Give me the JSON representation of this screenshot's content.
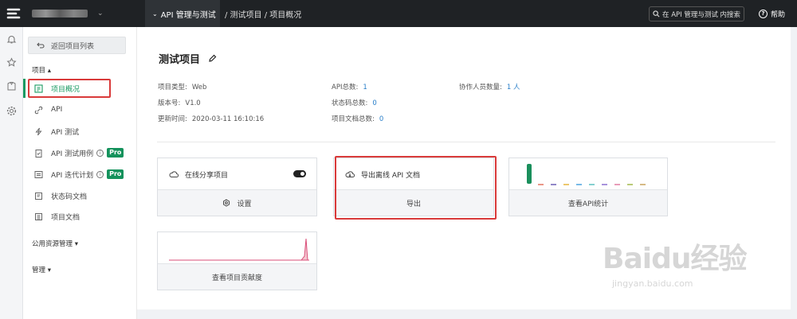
{
  "topbar": {
    "module": "API 管理与测试",
    "breadcrumb": "/ 测试项目 / 项目概况",
    "search_placeholder": "在 API 管理与测试 内搜索",
    "help": "帮助"
  },
  "sidebar": {
    "back": "返回项目列表",
    "section_project": "项目",
    "items": [
      {
        "label": "项目概况",
        "icon": "overview-icon",
        "active": true
      },
      {
        "label": "API",
        "icon": "link-icon"
      },
      {
        "label": "API 测试",
        "icon": "lightning-icon"
      },
      {
        "label": "API 测试用例",
        "icon": "clipboard-check-icon",
        "info": "i",
        "badge": "Pro"
      },
      {
        "label": "API 迭代计划",
        "icon": "list-icon",
        "info": "i",
        "badge": "Pro"
      },
      {
        "label": "状态码文档",
        "icon": "edit-doc-icon"
      },
      {
        "label": "项目文档",
        "icon": "document-icon"
      }
    ],
    "section_public": "公用资源管理",
    "section_manage": "管理"
  },
  "project": {
    "title": "测试项目",
    "type_label": "项目类型:",
    "type_value": "Web",
    "version_label": "版本号:",
    "version_value": "V1.0",
    "updated_label": "更新时间:",
    "updated_value": "2020-03-11 16:10:16",
    "api_total_label": "API总数:",
    "api_total_value": "1",
    "status_total_label": "状态码总数:",
    "status_total_value": "0",
    "doc_total_label": "项目文档总数:",
    "doc_total_value": "0",
    "members_label": "协作人员数量:",
    "members_value": "1 人"
  },
  "cards": {
    "share": {
      "title": "在线分享项目",
      "action": "设置"
    },
    "export": {
      "title": "导出离线 API 文档",
      "action": "导出"
    },
    "stats": {
      "action": "查看API统计",
      "colors": [
        "#1a8f5c",
        "#e2735f",
        "#6b5fb5",
        "#e5b43a",
        "#4aa3df",
        "#5cc0c0",
        "#8a6fd1",
        "#e07aa0",
        "#a3b84a",
        "#c9a35c"
      ]
    },
    "contrib": {
      "action": "查看项目贡献度"
    }
  },
  "watermark": {
    "big": "Baidu经验",
    "small": "jingyan.baidu.com"
  }
}
